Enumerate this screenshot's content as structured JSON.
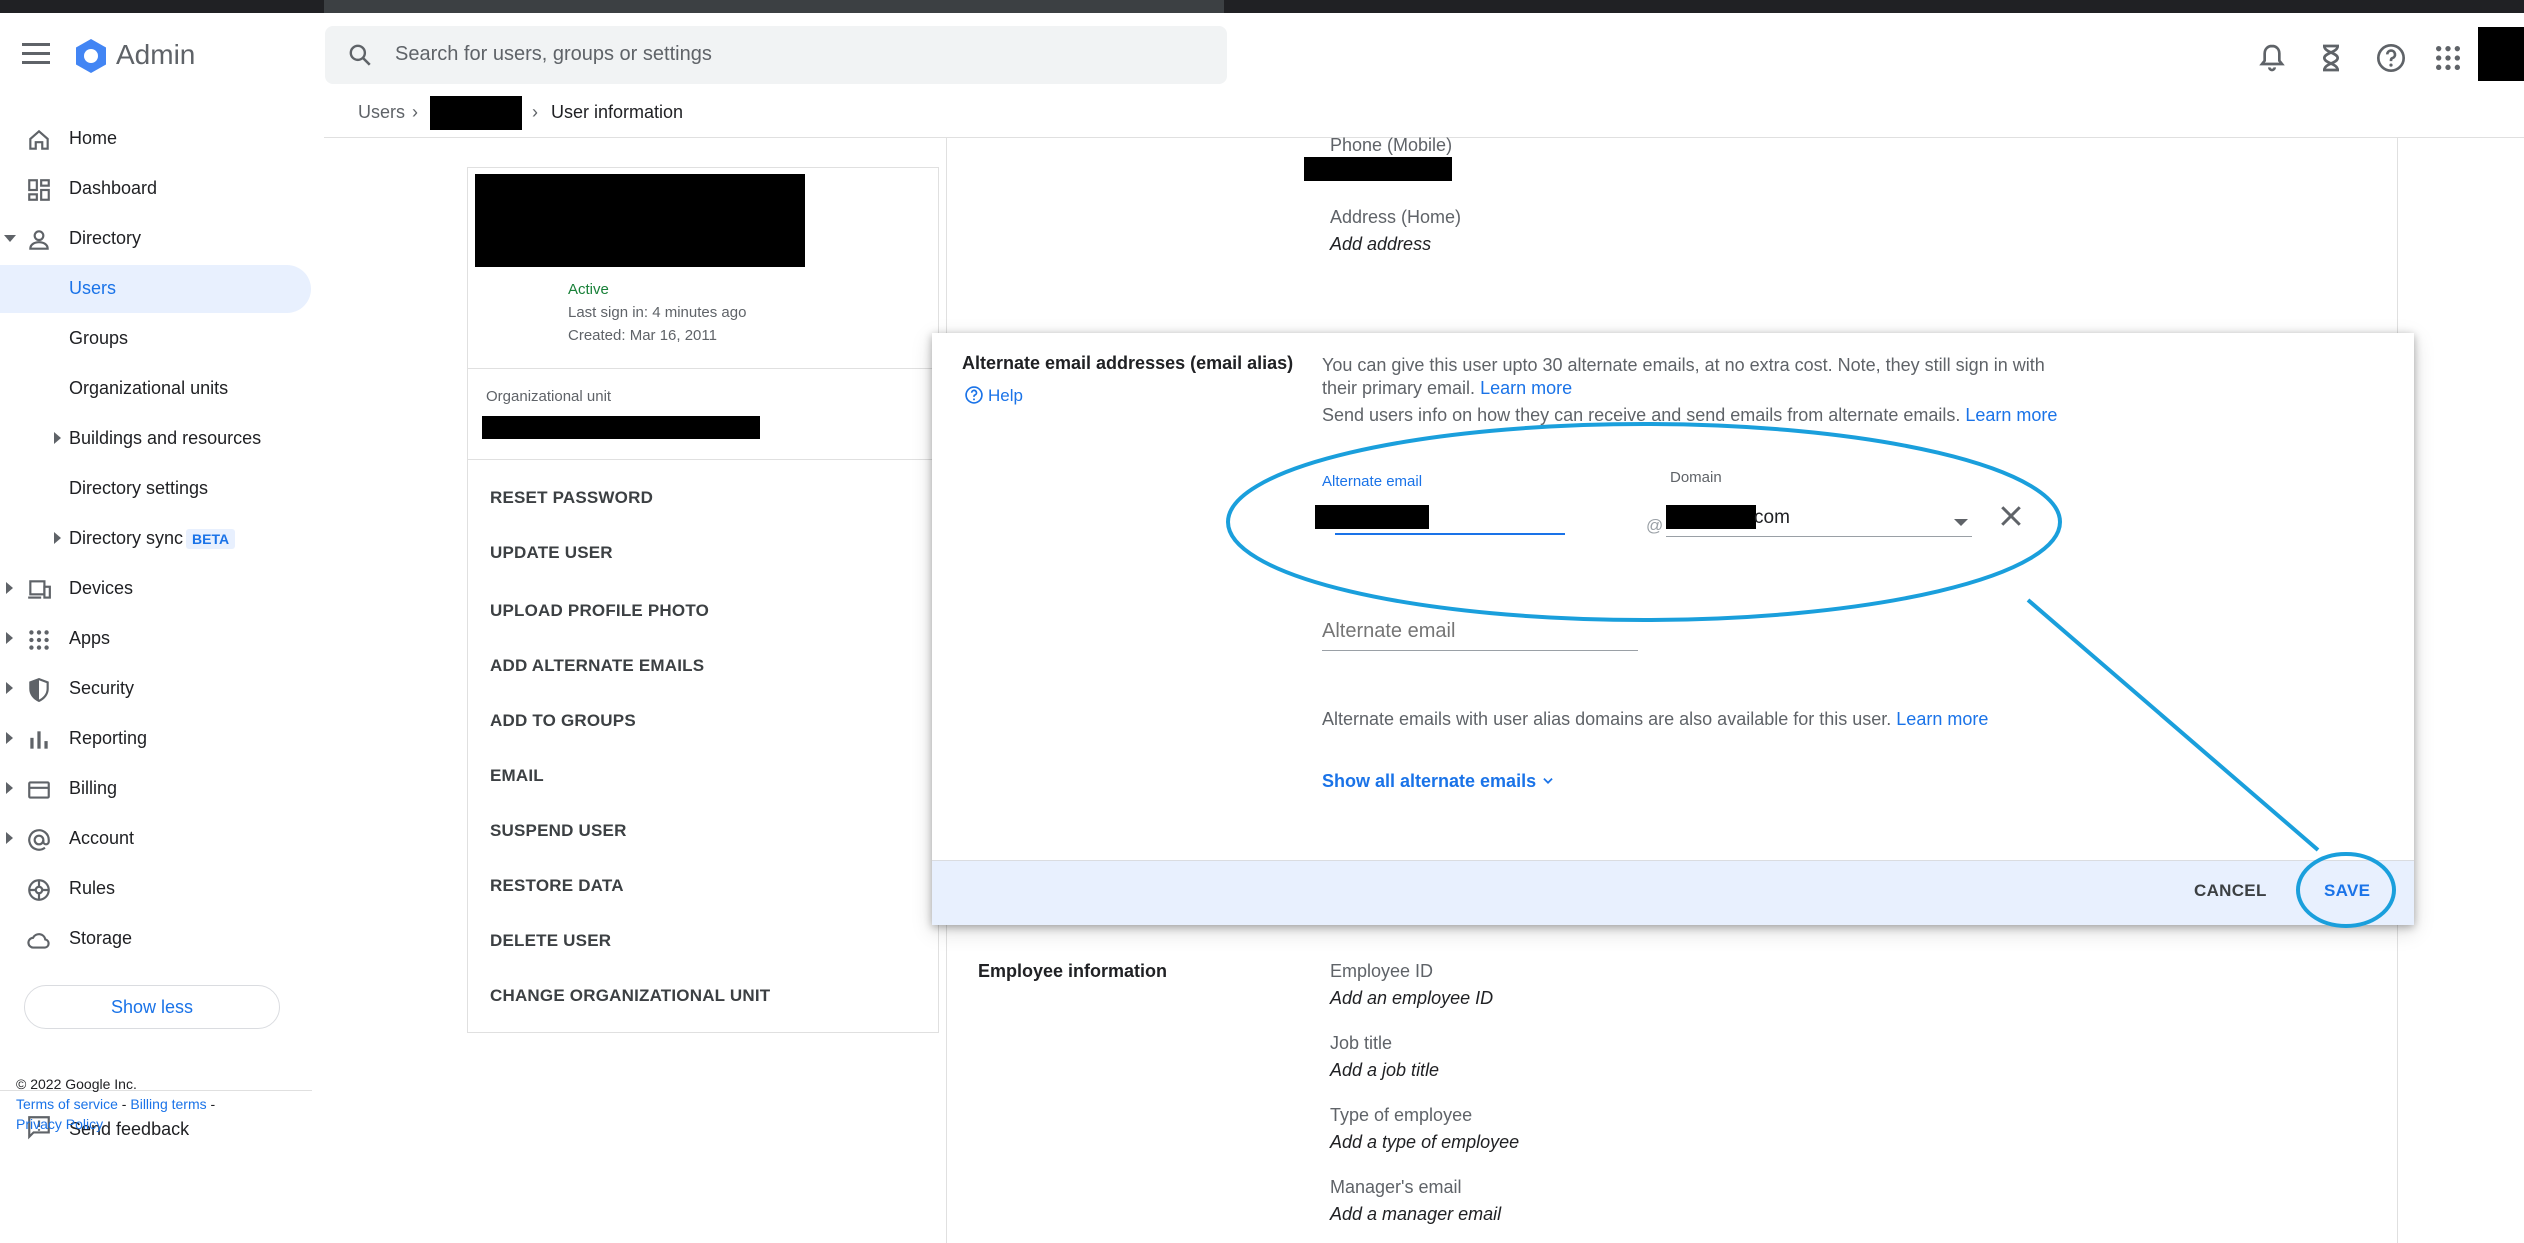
{
  "app": {
    "name": "Admin"
  },
  "search": {
    "placeholder": "Search for users, groups or settings"
  },
  "breadcrumb": {
    "root": "Users",
    "separator": "›",
    "current": "User information"
  },
  "sidebar": {
    "items": [
      {
        "label": "Home",
        "icon": "home-icon"
      },
      {
        "label": "Dashboard",
        "icon": "dashboard-icon"
      },
      {
        "label": "Directory",
        "icon": "person-icon"
      },
      {
        "label": "Users"
      },
      {
        "label": "Groups"
      },
      {
        "label": "Organizational units"
      },
      {
        "label": "Buildings and resources"
      },
      {
        "label": "Directory settings"
      },
      {
        "label": "Directory sync",
        "badge": "BETA"
      },
      {
        "label": "Devices",
        "icon": "devices-icon"
      },
      {
        "label": "Apps",
        "icon": "apps-grid-icon"
      },
      {
        "label": "Security",
        "icon": "shield-icon"
      },
      {
        "label": "Reporting",
        "icon": "bar-chart-icon"
      },
      {
        "label": "Billing",
        "icon": "credit-card-icon"
      },
      {
        "label": "Account",
        "icon": "at-sign-icon"
      },
      {
        "label": "Rules",
        "icon": "rules-icon"
      },
      {
        "label": "Storage",
        "icon": "cloud-icon"
      }
    ],
    "show_less": "Show less",
    "feedback": "Send feedback"
  },
  "footer": {
    "copyright": "© 2022 Google Inc.",
    "terms": "Terms of service",
    "sep": " - ",
    "billing_terms": "Billing terms",
    "sep2": " -",
    "privacy": "Privacy Policy"
  },
  "user_card": {
    "status": "Active",
    "last_sign_in": "Last sign in: 4 minutes ago",
    "created": "Created: Mar 16, 2011",
    "org_unit_label": "Organizational unit",
    "actions": [
      "RESET PASSWORD",
      "UPDATE USER",
      "UPLOAD PROFILE PHOTO",
      "ADD ALTERNATE EMAILS",
      "ADD TO GROUPS",
      "EMAIL",
      "SUSPEND USER",
      "RESTORE DATA",
      "DELETE USER",
      "CHANGE ORGANIZATIONAL UNIT"
    ]
  },
  "contact": {
    "phone_label": "Phone (Mobile)",
    "address_label": "Address (Home)",
    "address_value": "Add address"
  },
  "dialog": {
    "title": "Alternate email addresses (email alias)",
    "help": "Help",
    "desc_line1": "You can give this user upto 30 alternate emails, at no extra cost. Note, they still sign in with",
    "desc_line2": "their primary email.",
    "learn_more": "Learn more",
    "desc_line3": "Send users info on how they can receive and send emails from alternate emails.",
    "alt_email_label": "Alternate email",
    "at": "@",
    "domain_label": "Domain",
    "domain_suffix": "com",
    "alt_email_placeholder": "Alternate email",
    "alias_note": "Alternate emails with user alias domains are also available for this user.",
    "show_all": "Show all alternate emails",
    "cancel": "CANCEL",
    "save": "SAVE"
  },
  "employee": {
    "section_title": "Employee information",
    "fields": [
      {
        "label": "Employee ID",
        "value": "Add an employee ID"
      },
      {
        "label": "Job title",
        "value": "Add a job title"
      },
      {
        "label": "Type of employee",
        "value": "Add a type of employee"
      },
      {
        "label": "Manager's email",
        "value": "Add a manager email"
      }
    ]
  },
  "colors": {
    "accent": "#1a73e8",
    "annotation": "#1a9fdc",
    "active_status": "#188038"
  }
}
